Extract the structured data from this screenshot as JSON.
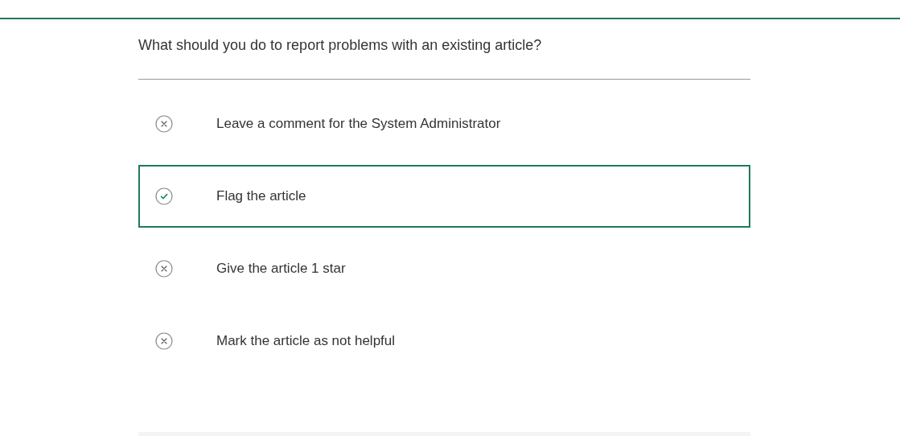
{
  "question": "What should you do to report problems with an existing article?",
  "options": [
    {
      "label": "Leave a comment for the System Administrator",
      "selected": false
    },
    {
      "label": "Flag the article",
      "selected": true
    },
    {
      "label": "Give the article 1 star",
      "selected": false
    },
    {
      "label": "Mark the article as not helpful",
      "selected": false
    }
  ]
}
